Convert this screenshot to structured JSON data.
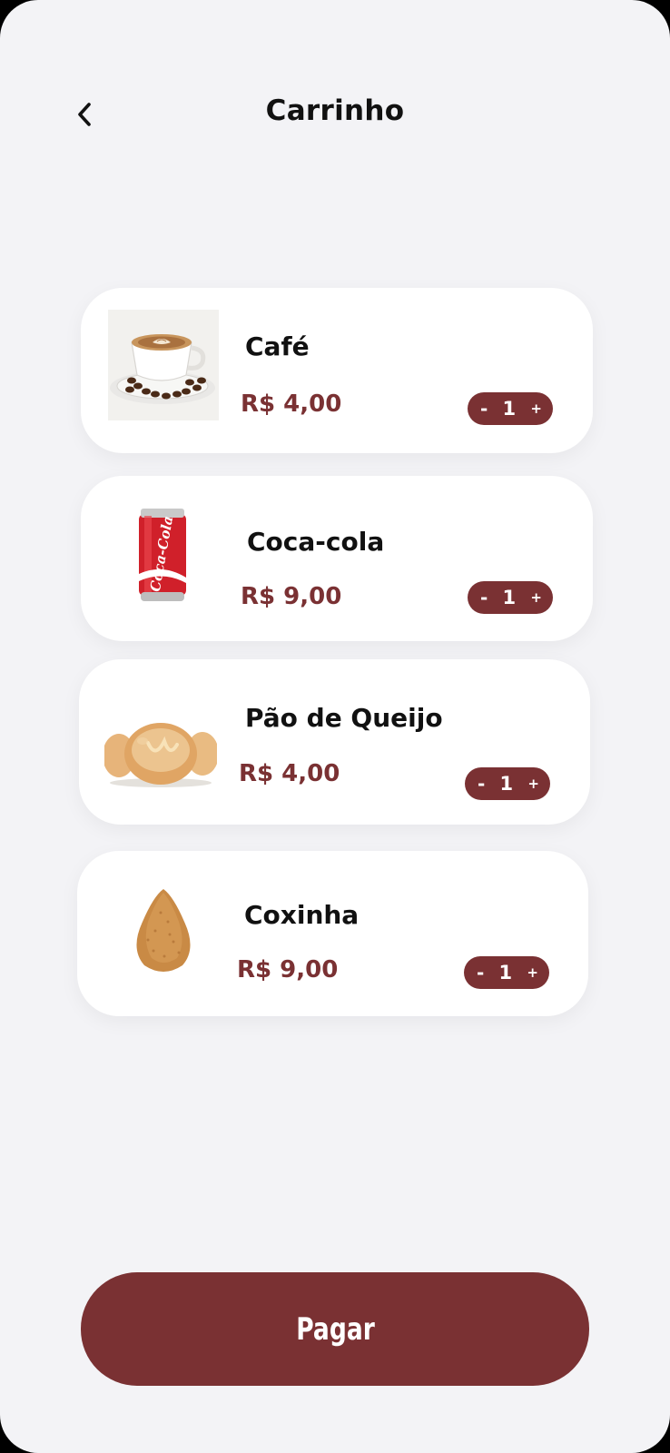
{
  "header": {
    "title": "Carrinho",
    "back_icon": "chevron-left-icon"
  },
  "cart": {
    "items": [
      {
        "name": "Café",
        "price": "R$ 4,00",
        "quantity": "1",
        "image": "coffee-cup"
      },
      {
        "name": "Coca-cola",
        "price": "R$ 9,00",
        "quantity": "1",
        "image": "soda-can"
      },
      {
        "name": "Pão de Queijo",
        "price": "R$ 4,00",
        "quantity": "1",
        "image": "cheese-bread"
      },
      {
        "name": "Coxinha",
        "price": "R$ 9,00",
        "quantity": "1",
        "image": "coxinha"
      }
    ],
    "stepper": {
      "minus_label": "-",
      "plus_label": "+"
    }
  },
  "footer": {
    "pay_label": "Pagar"
  },
  "colors": {
    "accent": "#7a3133",
    "background": "#f3f3f6",
    "card": "#ffffff",
    "text": "#111111"
  }
}
